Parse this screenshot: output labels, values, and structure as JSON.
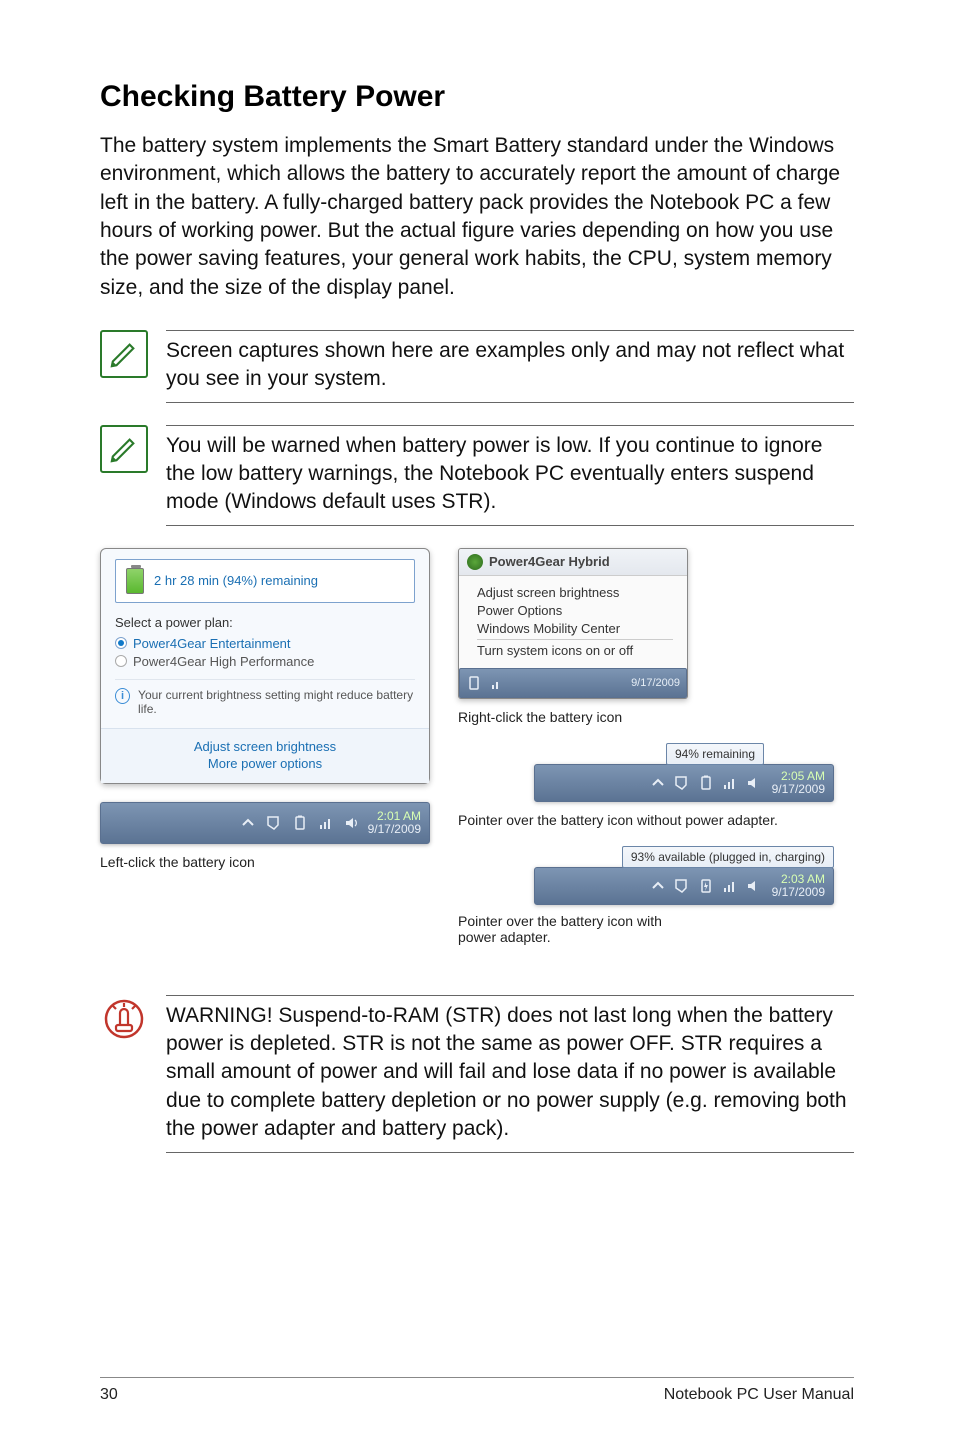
{
  "heading": "Checking Battery Power",
  "para1": "The battery system implements the Smart Battery standard under the Windows environment, which allows the battery to accurately report the amount of charge left in the battery. A fully-charged battery pack provides the Notebook PC a few hours of working power. But the actual figure varies depending on how you use the power saving features, your general work habits, the CPU, system memory size, and the size of the display panel.",
  "note1": "Screen captures shown here are examples only and may not reflect what you see in your system.",
  "note2": "You will be warned when battery power is low. If you continue to ignore the low battery warnings, the Notebook PC eventually enters suspend mode (Windows default uses STR).",
  "warn": "WARNING!  Suspend-to-RAM (STR) does not last long when the battery power is depleted. STR is not the same as power OFF. STR requires a small amount of power and will fail and lose data if no power is available due to complete battery depletion or no power supply (e.g. removing both the power adapter and battery pack).",
  "left_popup": {
    "remaining": "2 hr 28 min (94%) remaining",
    "plan_label": "Select a power plan:",
    "plan1": "Power4Gear Entertainment",
    "plan2": "Power4Gear High Performance",
    "info": "Your current brightness setting might reduce battery life.",
    "link1": "Adjust screen brightness",
    "link2": "More power options"
  },
  "left_taskbar": {
    "time": "2:01 AM",
    "date": "9/17/2009"
  },
  "left_caption": "Left-click the battery icon",
  "context_menu": {
    "title": "Power4Gear Hybrid",
    "i1": "Adjust screen brightness",
    "i2": "Power Options",
    "i3": "Windows Mobility Center",
    "i4": "Turn system icons on or off",
    "mini_date": "9/17/2009"
  },
  "right_caption1": "Right-click the battery icon",
  "tooltip1": "94% remaining",
  "right_tb1": {
    "time": "2:05 AM",
    "date": "9/17/2009"
  },
  "right_caption2": "Pointer over the battery icon without power adapter.",
  "tooltip2": "93% available (plugged in, charging)",
  "right_tb2": {
    "time": "2:03 AM",
    "date": "9/17/2009"
  },
  "right_caption3a": "Pointer over the battery icon with",
  "right_caption3b": "power adapter.",
  "footer": {
    "page": "30",
    "title": "Notebook PC User Manual"
  }
}
